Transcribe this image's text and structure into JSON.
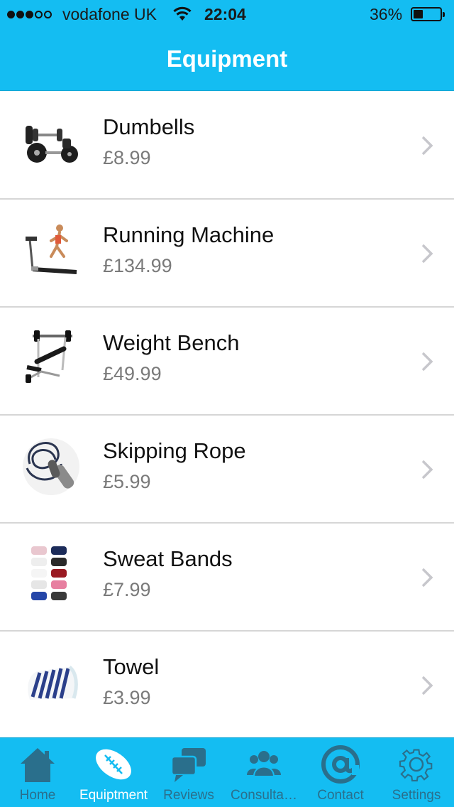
{
  "status_bar": {
    "carrier": "vodafone UK",
    "time": "22:04",
    "battery": "36%",
    "battery_level": 0.36,
    "signal_bars_filled": 3,
    "signal_bars_total": 5
  },
  "navbar": {
    "title": "Equipment"
  },
  "colors": {
    "accent": "#14bdf2",
    "tab_icon": "#2a6f8c",
    "active_tab": "#ffffff",
    "price_text": "#7a7a7a"
  },
  "items": [
    {
      "name": "Dumbells",
      "price": "£8.99",
      "icon": "dumbbells-image"
    },
    {
      "name": "Running Machine",
      "price": "£134.99",
      "icon": "treadmill-image"
    },
    {
      "name": "Weight Bench",
      "price": "£49.99",
      "icon": "weight-bench-image"
    },
    {
      "name": "Skipping Rope",
      "price": "£5.99",
      "icon": "skipping-rope-image"
    },
    {
      "name": "Sweat Bands",
      "price": "£7.99",
      "icon": "sweat-bands-image"
    },
    {
      "name": "Towel",
      "price": "£3.99",
      "icon": "towel-image"
    }
  ],
  "tabs": [
    {
      "label": "Home",
      "icon": "home-icon"
    },
    {
      "label": "Equiptment",
      "icon": "football-icon",
      "active": true
    },
    {
      "label": "Reviews",
      "icon": "chat-bubbles-icon"
    },
    {
      "label": "Consulta…",
      "icon": "people-icon"
    },
    {
      "label": "Contact",
      "icon": "at-sign-icon"
    },
    {
      "label": "Settings",
      "icon": "gear-icon"
    }
  ]
}
